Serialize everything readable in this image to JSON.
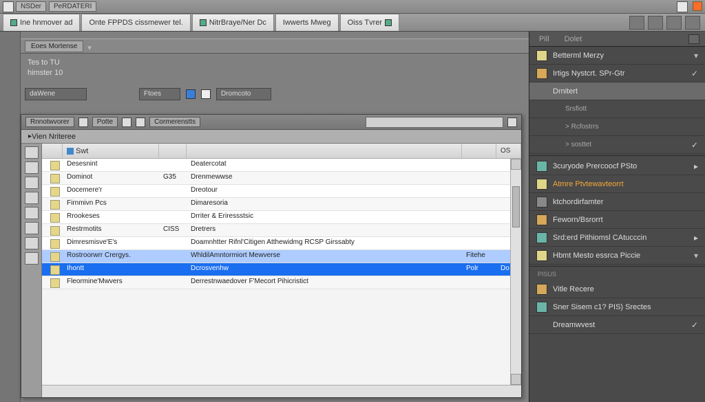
{
  "titlebar": {
    "app_tag": "NSDer",
    "doc_label": "PeRDATERI"
  },
  "doc_tabs": [
    {
      "label": "Ine hnmover ad"
    },
    {
      "label": "Onte FPPDS cissmewer tel."
    },
    {
      "label": "NitrBraye/Ner Dc"
    },
    {
      "label": "Iwwerts Mweg"
    },
    {
      "label": "Oiss Tvrer"
    }
  ],
  "secondary": {
    "tab1": "Eoes Mortense",
    "info1": "Tes to TU",
    "info2": "himster 10",
    "filter1": "daWene",
    "filter2": "Ftoes",
    "filter3": "Dromcoto"
  },
  "inner": {
    "tab_a": "Rnnotwvorer",
    "tab_b": "Potte",
    "tab_c": "Cormerenstts",
    "crumb": "Vien Nriteree",
    "hdr_name": "Swt",
    "hdr_os": "OS",
    "rows": [
      {
        "ic": "f",
        "n": "Desesnint",
        "s": "",
        "d": "Deatercotat",
        "t": "",
        "e": ""
      },
      {
        "ic": "f",
        "n": "Dominot",
        "s": "G35",
        "d": "Drenmewwse",
        "t": "",
        "e": ""
      },
      {
        "ic": "f",
        "n": "Docemere'r",
        "s": "",
        "d": "Dreotour",
        "t": "",
        "e": ""
      },
      {
        "ic": "f",
        "n": "Firnmivn Pcs",
        "s": "",
        "d": "Dimaresoria",
        "t": "",
        "e": ""
      },
      {
        "ic": "f",
        "n": "Rrookeses",
        "s": "",
        "d": "Drriter & Eriressstsic",
        "t": "",
        "e": ""
      },
      {
        "ic": "f",
        "n": "Restrmotits",
        "s": "CISS",
        "d": "Dretrers",
        "t": "",
        "e": ""
      },
      {
        "ic": "f",
        "n": "Dimresmisve'E's",
        "s": "",
        "d": "Doamnhtter Rifnl'Citigen Atthewidmg RCSP Girssabty",
        "t": "",
        "e": ""
      },
      {
        "ic": "f",
        "n": "Rostroorwrr Crergys.",
        "s": "",
        "d": "WhldilAmntormiort Mewverse",
        "t": "Fitehe",
        "e": ""
      },
      {
        "ic": "f",
        "n": "Ihontt",
        "s": "",
        "d": "Dcrosvenhw",
        "t": "Polr",
        "e": "Do"
      },
      {
        "ic": "f",
        "n": "Fleormine'Mwvers",
        "s": "",
        "d": "Derrestnwaedover F'Mecort Pihicristict",
        "t": "",
        "e": ""
      }
    ]
  },
  "panel": {
    "tab_a": "Pill",
    "tab_b": "Dolet",
    "items": [
      {
        "icon": "doc",
        "label": "Betterml Merzy",
        "mark": "chev"
      },
      {
        "icon": "fold",
        "label": "Irtigs Nystcrt. SPr-Gtr",
        "mark": "check"
      },
      {
        "icon": "",
        "label": "Drnitert",
        "sel": true,
        "mark": ""
      },
      {
        "icon": "",
        "label": "Srsfiott",
        "sub": true,
        "mark": ""
      },
      {
        "icon": "",
        "label": "> Rcfostrrs",
        "sub": true,
        "mark": ""
      },
      {
        "icon": "",
        "label": "> sosttet",
        "sub": true,
        "mark": "check"
      },
      {
        "icon": "img",
        "label": "3curyode Prercoocf PSto",
        "mark": "rt"
      },
      {
        "icon": "doc",
        "label": "Atmre Ptvtewavteorrt",
        "hl": true,
        "mark": ""
      },
      {
        "icon": "grid",
        "label": "ktchordirfamter",
        "mark": ""
      },
      {
        "icon": "fold",
        "label": "Feworn/Bsrorrt",
        "mark": ""
      },
      {
        "icon": "img",
        "label": "Srd:erd Pithiomsl CAtucccin",
        "mark": "rt"
      },
      {
        "icon": "doc",
        "label": "Hbmt Mesto essrca Piccie",
        "mark": "chev"
      }
    ],
    "footer_label": "Pisus",
    "footer_items": [
      {
        "icon": "fold",
        "label": "Vitle Recere"
      },
      {
        "icon": "img",
        "label": "Sner Sisem c1? PIS) Srectes"
      },
      {
        "icon": "",
        "label": "Dreamwvest",
        "mark": "check"
      }
    ]
  }
}
